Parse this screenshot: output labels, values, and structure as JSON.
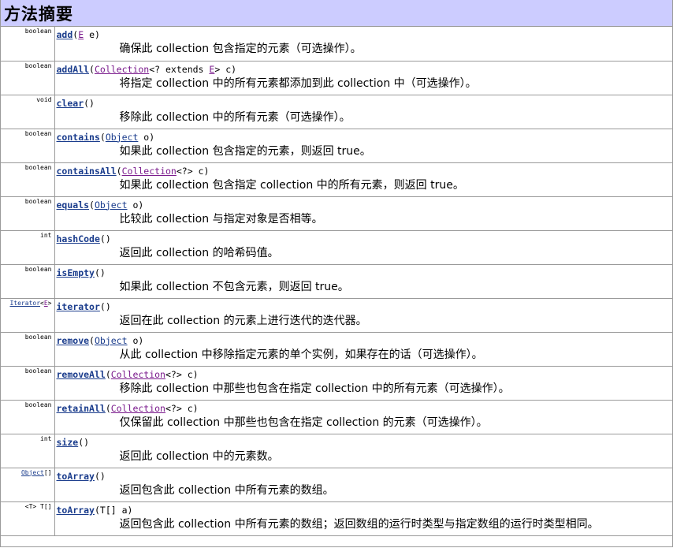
{
  "header": {
    "title": "方法摘要"
  },
  "methods": [
    {
      "type": "boolean",
      "name": "add",
      "sig_pre": "(",
      "p1_link": "E",
      "p1_rest": " e)",
      "desc": "确保此 collection 包含指定的元素（可选操作）。"
    },
    {
      "type": "boolean",
      "name": "addAll",
      "sig_pre": "(",
      "p1_link": "Collection",
      "p1_rest": "<? extends ",
      "p2_link": "E",
      "p2_rest": "> c)",
      "desc": "将指定 collection 中的所有元素都添加到此 collection 中（可选操作）。"
    },
    {
      "type": "void",
      "name": "clear",
      "sig_pre": "()",
      "desc": "移除此 collection 中的所有元素（可选操作）。"
    },
    {
      "type": "boolean",
      "name": "contains",
      "sig_pre": "(",
      "p1_link": "Object",
      "p1_rest": " o)",
      "desc": "如果此 collection 包含指定的元素，则返回 true。"
    },
    {
      "type": "boolean",
      "name": "containsAll",
      "sig_pre": "(",
      "p1_link": "Collection",
      "p1_rest": "<?> c)",
      "desc": "如果此 collection 包含指定 collection 中的所有元素，则返回 true。"
    },
    {
      "type": "boolean",
      "name": "equals",
      "sig_pre": "(",
      "p1_link": "Object",
      "p1_rest": " o)",
      "desc": "比较此 collection 与指定对象是否相等。"
    },
    {
      "type": "int",
      "name": "hashCode",
      "sig_pre": "()",
      "desc": "返回此 collection 的哈希码值。"
    },
    {
      "type": "boolean",
      "name": "isEmpty",
      "sig_pre": "()",
      "desc": "如果此 collection 不包含元素，则返回 true。"
    },
    {
      "type_link": "Iterator",
      "type_lt": "<",
      "type_link2": "E",
      "type_gt": ">",
      "name": "iterator",
      "sig_pre": "()",
      "desc": "返回在此 collection 的元素上进行迭代的迭代器。"
    },
    {
      "type": "boolean",
      "name": "remove",
      "sig_pre": "(",
      "p1_link": "Object",
      "p1_rest": " o)",
      "desc": "从此 collection 中移除指定元素的单个实例，如果存在的话（可选操作）。"
    },
    {
      "type": "boolean",
      "name": "removeAll",
      "sig_pre": "(",
      "p1_link": "Collection",
      "p1_rest": "<?> c)",
      "desc": "移除此 collection 中那些也包含在指定 collection 中的所有元素（可选操作）。"
    },
    {
      "type": "boolean",
      "name": "retainAll",
      "sig_pre": "(",
      "p1_link": "Collection",
      "p1_rest": "<?> c)",
      "desc": "仅保留此 collection 中那些也包含在指定 collection 的元素（可选操作）。"
    },
    {
      "type": "int",
      "name": "size",
      "sig_pre": "()",
      "desc": "返回此 collection 中的元素数。"
    },
    {
      "type_link": "Object",
      "type_after": "[]",
      "name": "toArray",
      "sig_pre": "()",
      "desc": "返回包含此 collection 中所有元素的数组。"
    },
    {
      "type": "<T> T[]",
      "name": "toArray",
      "sig_pre": "(T[] a)",
      "desc": "返回包含此 collection 中所有元素的数组；返回数组的运行时类型与指定数组的运行时类型相同。"
    }
  ]
}
